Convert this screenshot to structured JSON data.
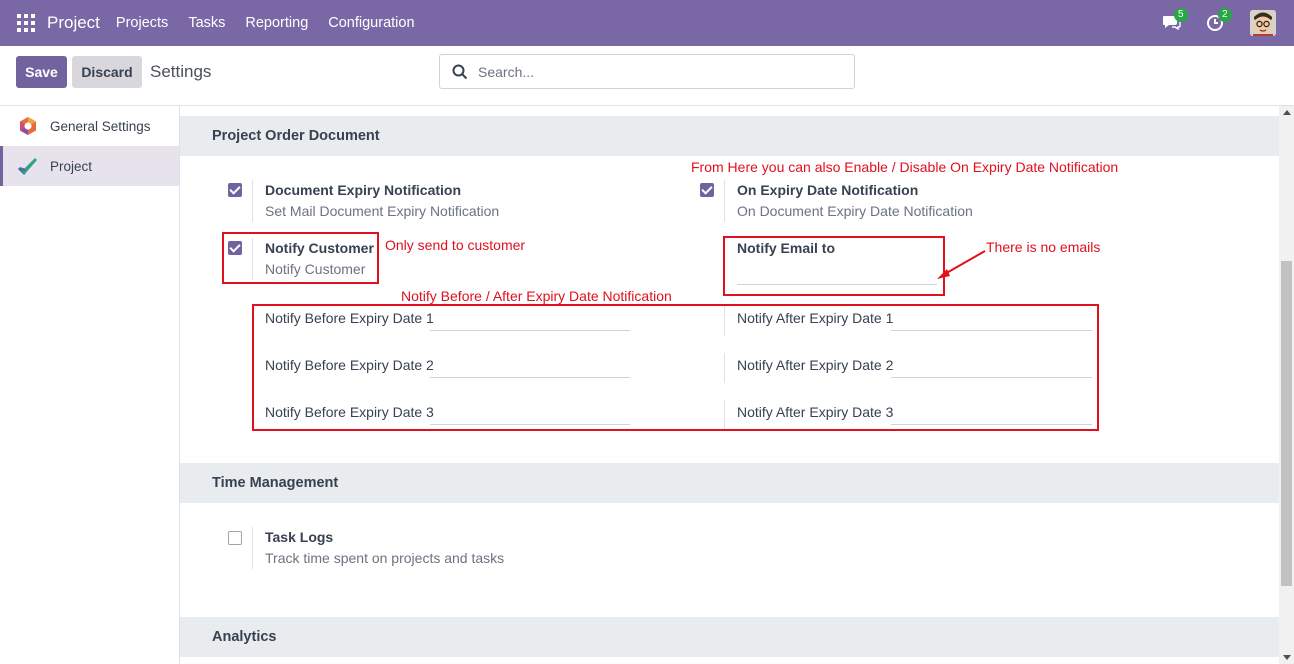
{
  "navbar": {
    "brand": "Project",
    "menu": [
      "Projects",
      "Tasks",
      "Reporting",
      "Configuration"
    ],
    "messages_count": "5",
    "activities_count": "2"
  },
  "control": {
    "save_label": "Save",
    "discard_label": "Discard",
    "title": "Settings",
    "search_placeholder": "Search..."
  },
  "sidebar": {
    "items": [
      {
        "label": "General Settings"
      },
      {
        "label": "Project"
      }
    ]
  },
  "sections": {
    "order_document": {
      "title": "Project Order Document",
      "doc_expiry": {
        "label": "Document Expiry Notification",
        "desc": "Set Mail Document Expiry Notification",
        "checked": true
      },
      "on_expiry": {
        "label": "On Expiry Date Notification",
        "desc": "On Document Expiry Date Notification",
        "checked": true
      },
      "notify_customer": {
        "label": "Notify Customer",
        "desc": "Notify Customer",
        "checked": true
      },
      "notify_email": {
        "label": "Notify Email to",
        "value": ""
      },
      "before": [
        "Notify Before Expiry Date 1",
        "Notify Before Expiry Date 2",
        "Notify Before Expiry Date 3"
      ],
      "after": [
        "Notify After Expiry Date 1",
        "Notify After Expiry Date 2",
        "Notify After Expiry Date 3"
      ]
    },
    "time_management": {
      "title": "Time Management",
      "task_logs": {
        "label": "Task Logs",
        "desc": "Track time spent on projects and tasks",
        "checked": false
      }
    },
    "analytics": {
      "title": "Analytics"
    }
  },
  "annotations": {
    "enable_disable": "From Here you can also Enable / Disable On Expiry Date Notification",
    "only_customer": "Only send to customer",
    "no_emails": "There is no emails",
    "before_after": "Notify Before / After Expiry Date Notification"
  },
  "colors": {
    "navbar": "#7a68a6",
    "primary": "#71639e",
    "annotation": "#e0101f"
  }
}
